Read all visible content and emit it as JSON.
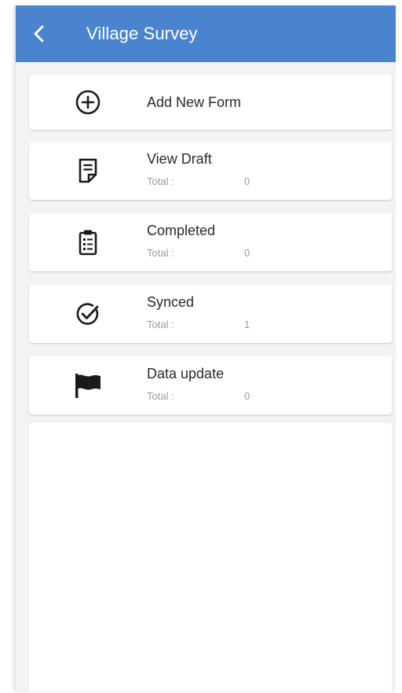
{
  "header": {
    "title": "Village Survey",
    "background": "#4a84cf"
  },
  "menu": {
    "add_new_form": {
      "label": "Add New Form",
      "icon": "add-circle-icon"
    },
    "view_draft": {
      "label": "View Draft",
      "total_label": "Total :",
      "total_value": "0",
      "icon": "draft-document-icon"
    },
    "completed": {
      "label": "Completed",
      "total_label": "Total :",
      "total_value": "0",
      "icon": "clipboard-icon"
    },
    "synced": {
      "label": "Synced",
      "total_label": "Total :",
      "total_value": "1",
      "icon": "check-circle-icon"
    },
    "data_update": {
      "label": "Data update",
      "total_label": "Total :",
      "total_value": "0",
      "icon": "flag-icon"
    }
  }
}
